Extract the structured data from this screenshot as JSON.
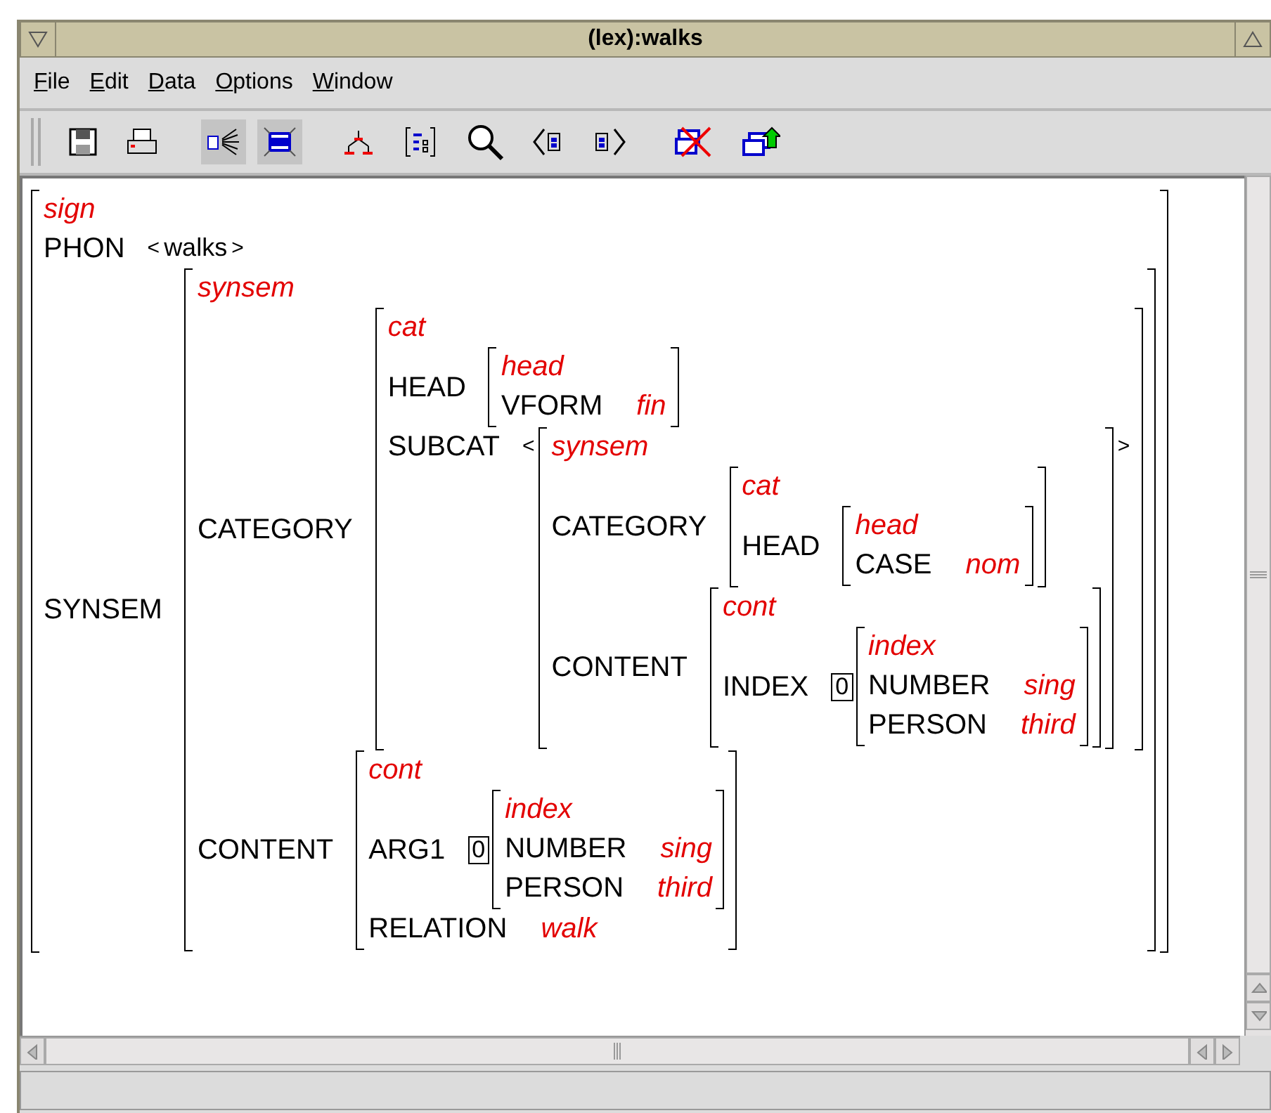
{
  "window": {
    "title": "(lex):walks"
  },
  "menu": [
    {
      "label": "File"
    },
    {
      "label": "Edit"
    },
    {
      "label": "Data"
    },
    {
      "label": "Options"
    },
    {
      "label": "Window"
    }
  ],
  "toolbar": [
    {
      "selected": false
    },
    {
      "selected": false
    },
    {
      "selected": true
    },
    {
      "selected": true
    },
    {
      "selected": false
    },
    {
      "selected": false
    },
    {
      "selected": false
    },
    {
      "selected": false
    },
    {
      "selected": false
    },
    {
      "selected": false
    },
    {
      "selected": false
    }
  ],
  "structure": {
    "kind": "avm",
    "type": "sign",
    "features": [
      {
        "name": "PHON",
        "value": {
          "kind": "list",
          "open": "<",
          "close": ">",
          "items": [
            {
              "kind": "word",
              "text": "walks"
            }
          ]
        }
      },
      {
        "name": "SYNSEM",
        "value": {
          "kind": "avm",
          "type": "synsem",
          "features": [
            {
              "name": "CATEGORY",
              "value": {
                "kind": "avm",
                "type": "cat",
                "features": [
                  {
                    "name": "HEAD",
                    "value": {
                      "kind": "avm",
                      "type": "head",
                      "features": [
                        {
                          "name": "VFORM",
                          "value": {
                            "kind": "atom",
                            "text": "fin"
                          }
                        }
                      ]
                    }
                  },
                  {
                    "name": "SUBCAT",
                    "value": {
                      "kind": "list",
                      "open": "<",
                      "close": ">",
                      "items": [
                        {
                          "kind": "avm",
                          "type": "synsem",
                          "features": [
                            {
                              "name": "CATEGORY",
                              "value": {
                                "kind": "avm",
                                "type": "cat",
                                "features": [
                                  {
                                    "name": "HEAD",
                                    "value": {
                                      "kind": "avm",
                                      "type": "head",
                                      "features": [
                                        {
                                          "name": "CASE",
                                          "value": {
                                            "kind": "atom",
                                            "text": "nom"
                                          }
                                        }
                                      ]
                                    }
                                  }
                                ]
                              }
                            },
                            {
                              "name": "CONTENT",
                              "value": {
                                "kind": "avm",
                                "type": "cont",
                                "features": [
                                  {
                                    "name": "INDEX",
                                    "value": {
                                      "kind": "tagged",
                                      "tag": "0",
                                      "value": {
                                        "kind": "avm",
                                        "type": "index",
                                        "features": [
                                          {
                                            "name": "NUMBER",
                                            "value": {
                                              "kind": "atom",
                                              "text": "sing"
                                            }
                                          },
                                          {
                                            "name": "PERSON",
                                            "value": {
                                              "kind": "atom",
                                              "text": "third"
                                            }
                                          }
                                        ]
                                      }
                                    }
                                  }
                                ]
                              }
                            }
                          ]
                        }
                      ]
                    }
                  }
                ]
              }
            },
            {
              "name": "CONTENT",
              "value": {
                "kind": "avm",
                "type": "cont",
                "features": [
                  {
                    "name": "ARG1",
                    "value": {
                      "kind": "tagged",
                      "tag": "0",
                      "value": {
                        "kind": "avm",
                        "type": "index",
                        "features": [
                          {
                            "name": "NUMBER",
                            "value": {
                              "kind": "atom",
                              "text": "sing"
                            }
                          },
                          {
                            "name": "PERSON",
                            "value": {
                              "kind": "atom",
                              "text": "third"
                            }
                          }
                        ]
                      }
                    }
                  },
                  {
                    "name": "RELATION",
                    "value": {
                      "kind": "atom",
                      "text": "walk"
                    }
                  }
                ]
              }
            }
          ]
        }
      }
    ]
  }
}
